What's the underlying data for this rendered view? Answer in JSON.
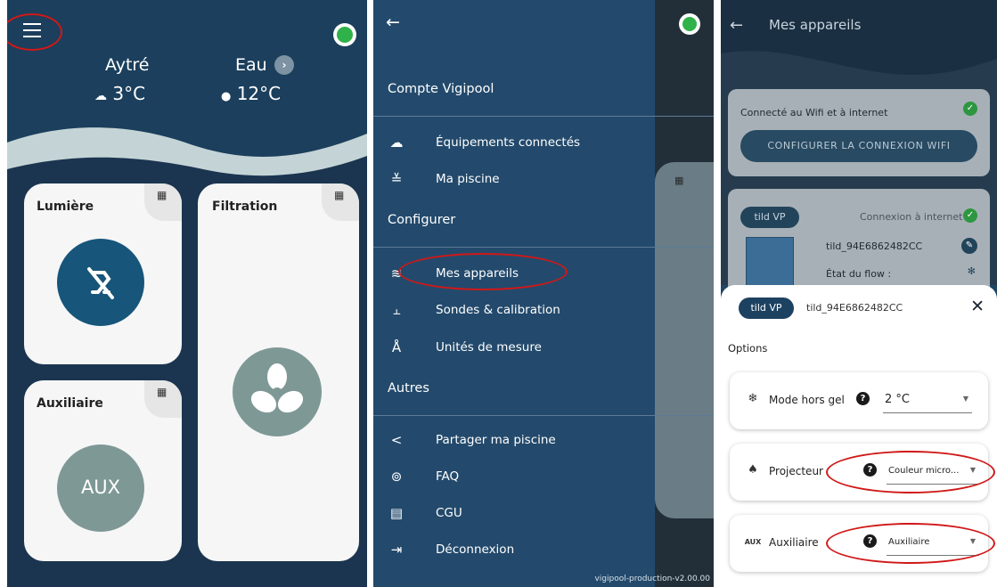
{
  "colors": {
    "app_bg": "#1b3f5c",
    "drawer_bg": "#234a6c",
    "accent": "#17557a",
    "grey_button": "#7e9896",
    "status_green": "#2fb24a",
    "highlight_red": "#d01818"
  },
  "home": {
    "city": "Aytré",
    "air_temp": "3°C",
    "water_label": "Eau",
    "water_temp": "12°C",
    "cards": {
      "light": {
        "title": "Lumière"
      },
      "filtration": {
        "title": "Filtration"
      },
      "aux": {
        "title": "Auxiliaire",
        "button_label": "AUX"
      }
    }
  },
  "drawer": {
    "account_header": "Compte Vigipool",
    "items_account": [
      {
        "label": "Équipements connectés",
        "icon": "cloud-icon"
      },
      {
        "label": "Ma piscine",
        "icon": "pool-icon"
      }
    ],
    "configure_header": "Configurer",
    "items_configure": [
      {
        "label": "Mes appareils",
        "icon": "devices-icon"
      },
      {
        "label": "Sondes & calibration",
        "icon": "sliders-icon"
      },
      {
        "label": "Unités de mesure",
        "icon": "compass-icon"
      }
    ],
    "others_header": "Autres",
    "items_others": [
      {
        "label": "Partager ma piscine",
        "icon": "share-icon"
      },
      {
        "label": "FAQ",
        "icon": "help-icon"
      },
      {
        "label": "CGU",
        "icon": "document-icon"
      },
      {
        "label": "Déconnexion",
        "icon": "logout-icon"
      }
    ],
    "version": "vigipool-production-v2.00.00"
  },
  "devices": {
    "title": "Mes appareils",
    "wifi_status": "Connecté au Wifi et à internet",
    "wifi_button": "CONFIGURER LA CONNEXION WIFI",
    "device_badge": "tild VP",
    "internet_status": "Connexion à internet",
    "device_name": "tild_94E6862482CC",
    "flow_label": "État du flow :",
    "sheet": {
      "badge": "tild VP",
      "device_name": "tild_94E6862482CC",
      "options_title": "Options",
      "options": [
        {
          "label": "Mode hors gel",
          "value": "2 °C",
          "icon": "snowflake-icon"
        },
        {
          "label": "Projecteur",
          "value": "Couleur micro...",
          "icon": "spotlight-icon"
        },
        {
          "label": "Auxiliaire",
          "value": "Auxiliaire",
          "icon_text": "AUX"
        }
      ]
    }
  }
}
